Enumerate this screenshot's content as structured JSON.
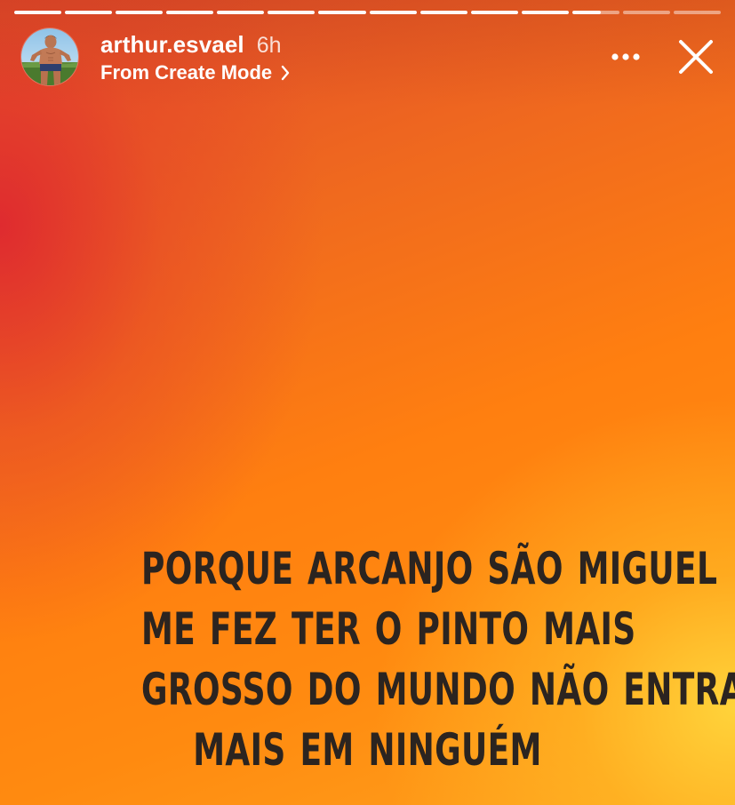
{
  "story": {
    "progress": {
      "segment_count": 14,
      "completed_segments": 11,
      "current_segment_fraction": 0.6
    },
    "header": {
      "avatar_icon": "profile-avatar",
      "username": "arthur.esvael",
      "time_ago": "6h",
      "source_label": "From Create Mode",
      "source_chevron_icon": "chevron-right-icon",
      "more_icon": "more-horizontal-icon",
      "close_icon": "close-icon"
    },
    "caption": {
      "lines": [
        "PORQUE ARCANJO SÃO MIGUEL",
        "ME FEZ TER O PINTO MAIS",
        "GROSSO DO MUNDO NÃO ENTRA",
        "MAIS EM NINGUÉM"
      ]
    },
    "colors": {
      "background_top_left": "#de2a30",
      "background_mid": "#ff8210",
      "background_bottom_right": "#ffd63c",
      "caption_text": "#2b2420",
      "header_text": "#ffffff"
    }
  }
}
